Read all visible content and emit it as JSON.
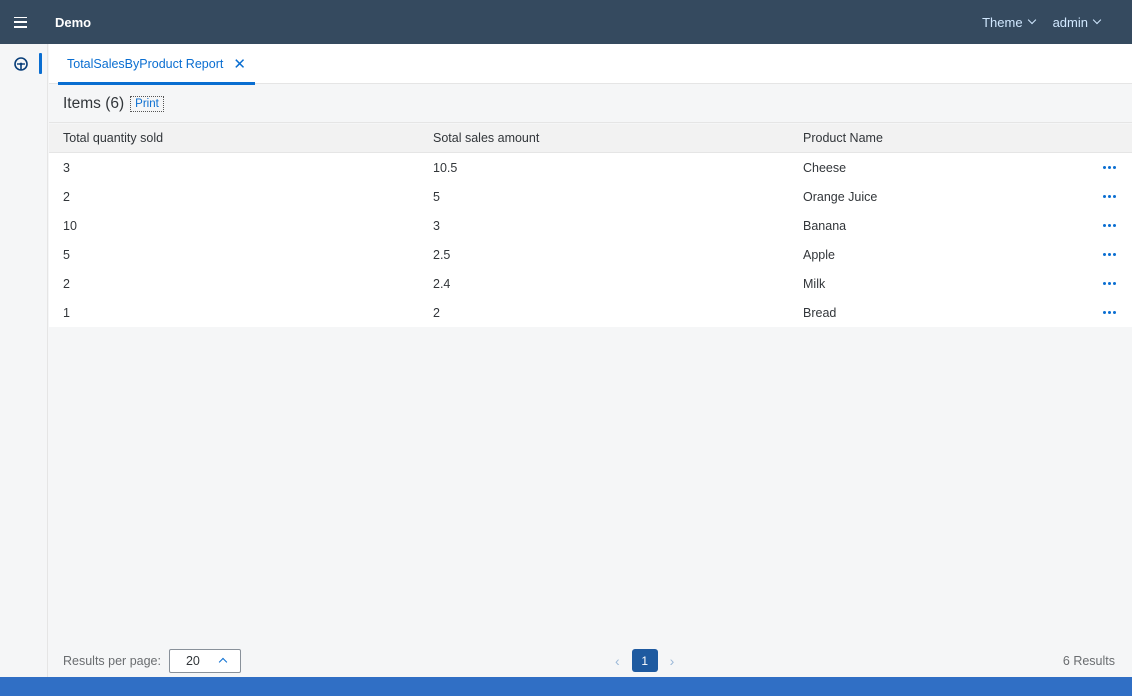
{
  "shell": {
    "title": "Demo",
    "menu_icon": "hamburger-icon",
    "theme_label": "Theme",
    "user_label": "admin"
  },
  "sidenav": {
    "items": [
      {
        "icon": "dashboard-gauge-icon",
        "active": true
      }
    ]
  },
  "tabs": [
    {
      "label": "TotalSalesByProduct Report",
      "active": true,
      "close_icon": "close-icon"
    }
  ],
  "toolbar": {
    "items_label": "Items (6)",
    "print_label": "Print"
  },
  "table": {
    "columns": [
      "Total quantity sold",
      "Sotal sales amount",
      "Product Name"
    ],
    "rows": [
      [
        "3",
        "10.5",
        "Cheese"
      ],
      [
        "2",
        "5",
        "Orange Juice"
      ],
      [
        "10",
        "3",
        "Banana"
      ],
      [
        "5",
        "2.5",
        "Apple"
      ],
      [
        "2",
        "2.4",
        "Milk"
      ],
      [
        "1",
        "2",
        "Bread"
      ]
    ],
    "row_action_icon": "more-actions-icon"
  },
  "footer": {
    "results_per_page_label": "Results per page:",
    "results_per_page_value": "20",
    "current_page": "1",
    "results_count": "6 Results"
  },
  "colors": {
    "shellbar": "#354a5f",
    "accent": "#0a6ed1",
    "active_page": "#1e5aa0",
    "statusbar": "#306fc5"
  }
}
